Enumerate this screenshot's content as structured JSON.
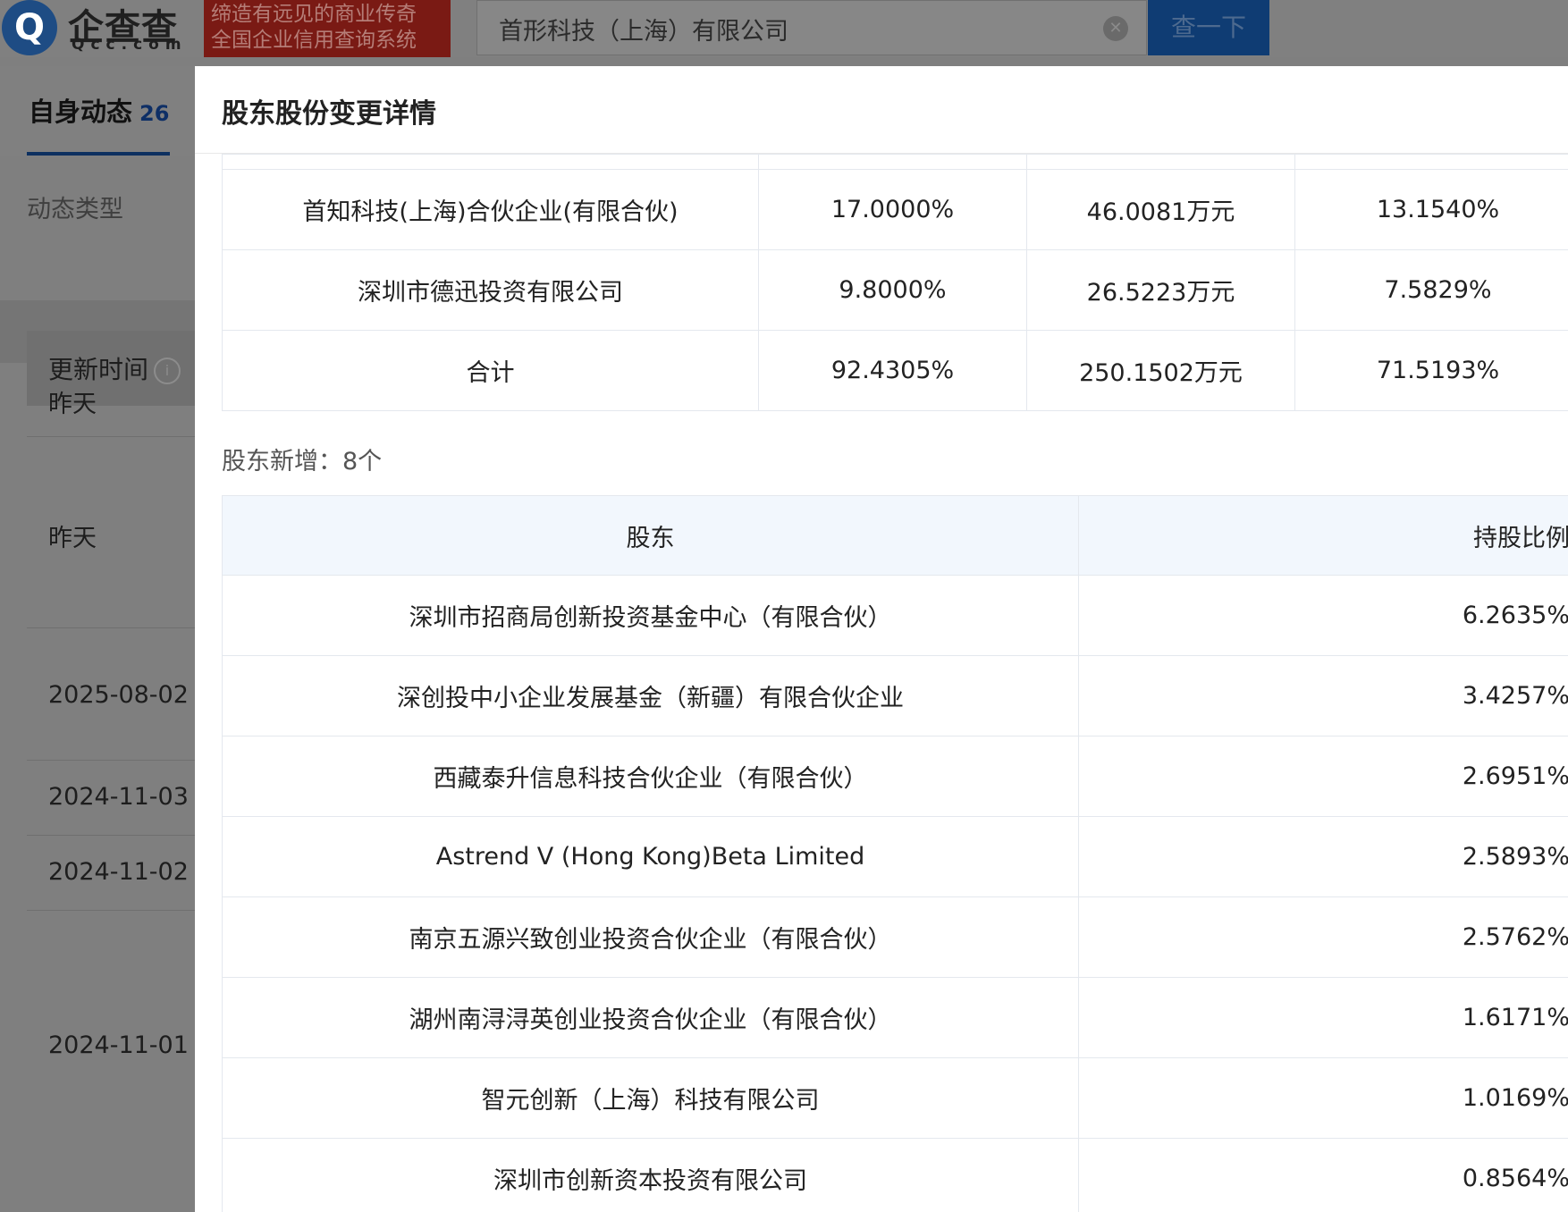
{
  "header": {
    "logo_mark": "Q",
    "logo_cn": "企查查",
    "logo_en": "Qcc.com",
    "slogan_line1": "缔造有远见的商业传奇",
    "slogan_line2": "全国企业信用查询系统",
    "search_value": "首形科技（上海）有限公司",
    "search_button": "查一下"
  },
  "sidebar": {
    "tab_label": "自身动态",
    "tab_count": "26",
    "filter_label": "动态类型",
    "column_header": "更新时间",
    "times": [
      "昨天",
      "昨天",
      "2025-08-02",
      "2024-11-03",
      "2024-11-02",
      "2024-11-01"
    ]
  },
  "modal": {
    "title": "股东股份变更详情",
    "top_table": {
      "rows": [
        {
          "name": "首知科技(上海)合伙企业(有限合伙)",
          "c2": "17.0000%",
          "c3": "46.0081万元",
          "c4": "13.1540%",
          "link": true
        },
        {
          "name": "深圳市德迅投资有限公司",
          "c2": "9.8000%",
          "c3": "26.5223万元",
          "c4": "7.5829%",
          "link": true
        },
        {
          "name": "合计",
          "c2": "92.4305%",
          "c3": "250.1502万元",
          "c4": "71.5193%",
          "link": false
        }
      ]
    },
    "new_shareholders_label": "股东新增：8个",
    "new_table": {
      "headers": [
        "股东",
        "持股比例"
      ],
      "rows": [
        {
          "name": "深圳市招商局创新投资基金中心（有限合伙）",
          "pct": "6.2635%"
        },
        {
          "name": "深创投中小企业发展基金（新疆）有限合伙企业",
          "pct": "3.4257%"
        },
        {
          "name": "西藏泰升信息科技合伙企业（有限合伙）",
          "pct": "2.6951%"
        },
        {
          "name": "Astrend V (Hong Kong)Beta Limited",
          "pct": "2.5893%"
        },
        {
          "name": "南京五源兴致创业投资合伙企业（有限合伙）",
          "pct": "2.5762%"
        },
        {
          "name": "湖州南浔浔英创业投资合伙企业（有限合伙）",
          "pct": "1.6171%"
        },
        {
          "name": "智元创新（上海）科技有限公司",
          "pct": "1.0169%"
        },
        {
          "name": "深圳市创新资本投资有限公司",
          "pct": "0.8564%"
        }
      ]
    }
  }
}
